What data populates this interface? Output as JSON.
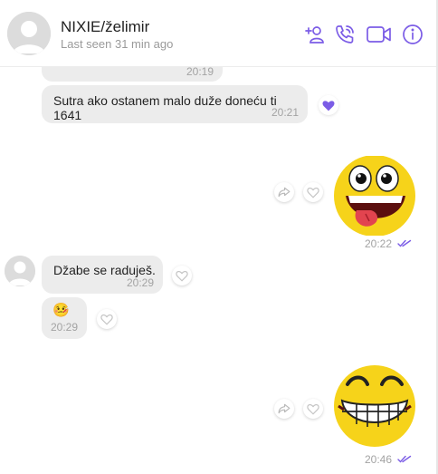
{
  "header": {
    "name": "NIXIE/želimir",
    "status": "Last seen 31 min ago"
  },
  "messages": {
    "m0_time": "20:19",
    "m1_text": "Sutra ako ostanem malo duže donеću ti 1641",
    "m1_time": "20:21",
    "s1_time": "20:22",
    "m2_text": "Džabe se raduješ.",
    "m2_time": "20:29",
    "m3_emoji": "🤒",
    "m3_time": "20:29",
    "s2_time": "20:46"
  },
  "colors": {
    "accent": "#7b5ce6",
    "bubble": "#ececec",
    "sticker_yellow": "#f6d31a"
  },
  "icons": [
    "add-contact-icon",
    "phone-icon",
    "video-icon",
    "info-icon",
    "share-icon",
    "heart-icon",
    "liked-heart-icon",
    "read-ticks-icon"
  ]
}
